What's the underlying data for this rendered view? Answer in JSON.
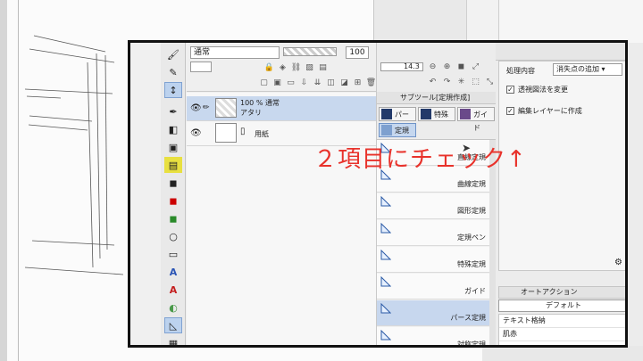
{
  "layer_panel": {
    "blend_mode": "通常",
    "opacity": "100",
    "layers": [
      {
        "percent": "100 %",
        "mode": "通常",
        "name": "アタリ"
      },
      {
        "name": "用紙"
      }
    ]
  },
  "toolbar": {
    "zoom_value": "14.3"
  },
  "subtool": {
    "header": "サブツール[定規作成]",
    "tabs": [
      "パース",
      "特殊",
      "ガイド",
      "定規"
    ],
    "items": [
      "直線定規",
      "曲線定規",
      "図形定規",
      "定規ペン",
      "特殊定規",
      "ガイド",
      "パース定規",
      "対称定規"
    ]
  },
  "tool_property": {
    "label": "処理内容",
    "select_value": "消失点の追加",
    "checks": [
      {
        "label": "透視図法を変更",
        "checked": true
      },
      {
        "label": "編集レイヤーに作成",
        "checked": true
      }
    ]
  },
  "auto_action": {
    "title": "オートアクション",
    "select": "デフォルト",
    "items": [
      "テキスト格納",
      "肌赤"
    ]
  },
  "annotation": "２項目にチェック↑",
  "colors": {
    "annotation": "#e8322b",
    "selection": "#c7d7ee",
    "accent": "#233a6a"
  },
  "icons": [
    "eye-icon",
    "pen-icon",
    "ruler-icon",
    "checkbox-icon",
    "dropdown-icon",
    "zoom-icon"
  ]
}
